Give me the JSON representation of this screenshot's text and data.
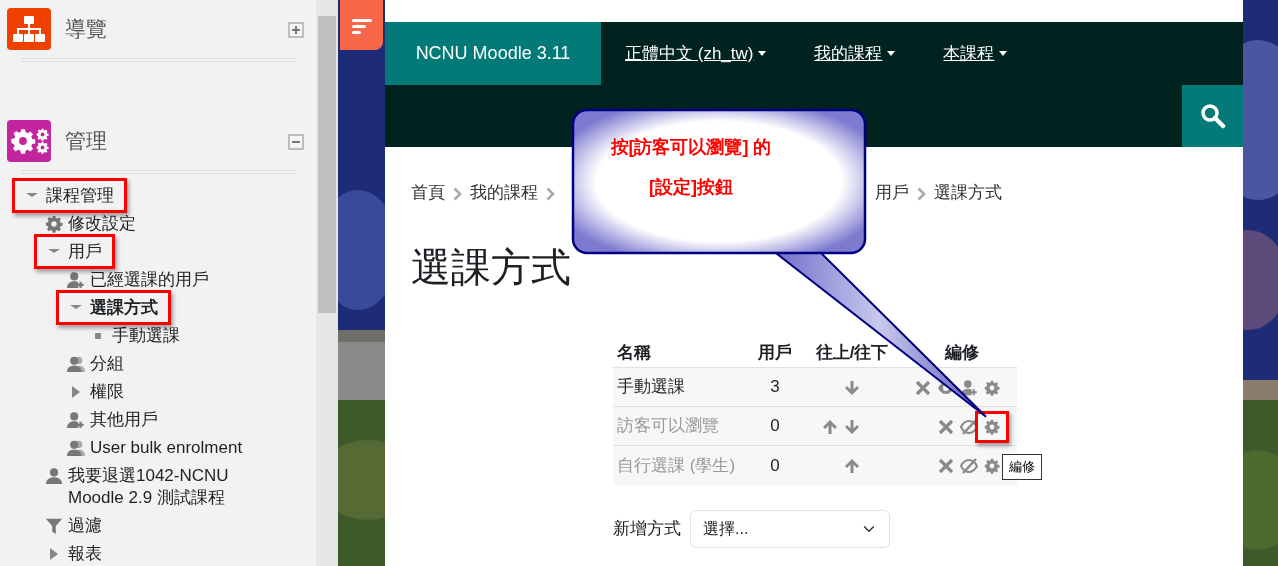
{
  "sidebar": {
    "blocks": [
      {
        "title": "導覽",
        "kind": "navigation",
        "collapsed": true
      },
      {
        "title": "管理",
        "kind": "admin",
        "collapsed": false,
        "items": [
          {
            "label": "課程管理",
            "kind": "branch",
            "expanded": true,
            "highlighted": true,
            "selected": false,
            "children": [
              {
                "label": "修改設定",
                "kind": "gear",
                "highlighted": false,
                "selected": false
              },
              {
                "label": "用戶",
                "kind": "branch",
                "expanded": true,
                "highlighted": true,
                "selected": false,
                "children": [
                  {
                    "label": "已經選課的用戶",
                    "kind": "user-add",
                    "highlighted": false,
                    "selected": false
                  },
                  {
                    "label": "選課方式",
                    "kind": "branch",
                    "expanded": true,
                    "highlighted": true,
                    "selected": true,
                    "children": [
                      {
                        "label": "手動選課",
                        "kind": "bullet",
                        "highlighted": false,
                        "selected": false
                      }
                    ]
                  },
                  {
                    "label": "分組",
                    "kind": "users",
                    "highlighted": false,
                    "selected": false
                  },
                  {
                    "label": "權限",
                    "kind": "branch",
                    "expanded": false,
                    "highlighted": false,
                    "selected": false
                  },
                  {
                    "label": "其他用戶",
                    "kind": "user-add",
                    "highlighted": false,
                    "selected": false
                  },
                  {
                    "label": "User bulk enrolment",
                    "kind": "users",
                    "highlighted": false,
                    "selected": false
                  }
                ]
              },
              {
                "label": "我要退選1042-NCNU Moodle 2.9 測試課程",
                "kind": "user",
                "highlighted": false,
                "selected": false
              },
              {
                "label": "過濾",
                "kind": "filter",
                "highlighted": false,
                "selected": false
              },
              {
                "label": "報表",
                "kind": "branch",
                "expanded": false,
                "highlighted": false,
                "selected": false
              }
            ]
          }
        ]
      }
    ]
  },
  "navbar": {
    "brand": "NCNU Moodle 3.11",
    "menus": [
      {
        "label": "正體中文 (zh_tw)",
        "dropdown": true
      },
      {
        "label": "我的課程",
        "dropdown": true
      },
      {
        "label": "本課程",
        "dropdown": true
      }
    ]
  },
  "breadcrumb": [
    "首頁",
    "我的課程",
    "用戶",
    "選課方式"
  ],
  "page_title": "選課方式",
  "table": {
    "columns": [
      "名稱",
      "用戶",
      "往上/往下",
      "編修"
    ],
    "rows": [
      {
        "name": "手動選課",
        "users": "3",
        "enabled": true,
        "can_move_up": false,
        "can_move_down": true,
        "can_enrol": true,
        "highlighted": false
      },
      {
        "name": "訪客可以瀏覽",
        "users": "0",
        "enabled": false,
        "can_move_up": true,
        "can_move_down": true,
        "can_enrol": false,
        "highlighted": true
      },
      {
        "name": "自行選課 (學生)",
        "users": "0",
        "enabled": false,
        "can_move_up": true,
        "can_move_down": false,
        "can_enrol": false,
        "highlighted": false,
        "tooltip": "編修"
      }
    ]
  },
  "add_method": {
    "label": "新增方式",
    "value": "選擇..."
  },
  "callout": {
    "lines": [
      "按[訪客可以瀏覽] 的",
      "[設定]按鈕"
    ]
  }
}
